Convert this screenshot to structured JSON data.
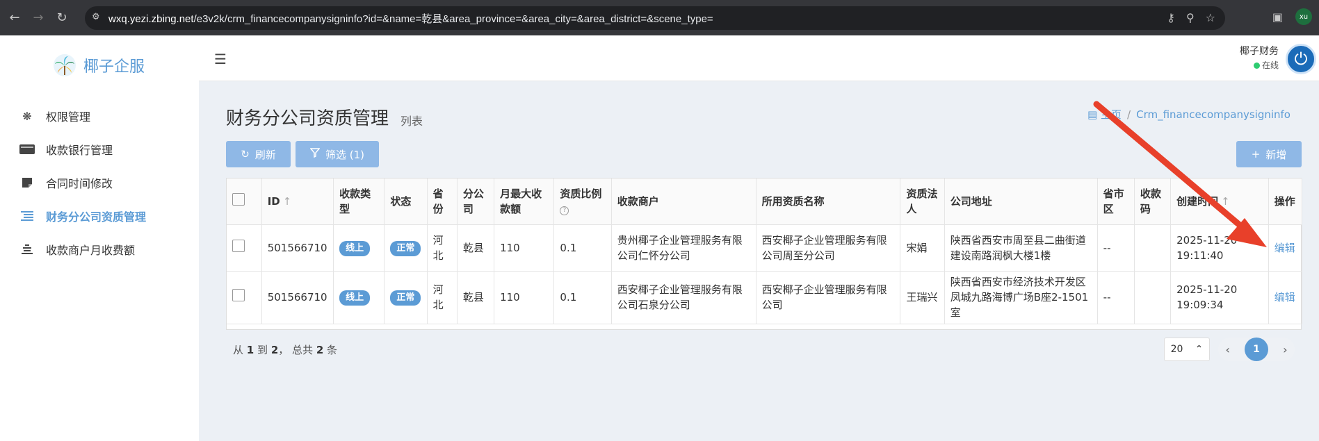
{
  "browser": {
    "url_host": "wxq.yezi.zbing.net",
    "url_path": "/e3v2k/crm_financecompanysigninfo?id=&name=乾县&area_province=&area_city=&area_district=&scene_type=",
    "profile_initials": "xu"
  },
  "sidebar": {
    "logo_text": "椰子企服",
    "items": [
      {
        "label": "权限管理",
        "icon": "fingerprint-icon"
      },
      {
        "label": "收款银行管理",
        "icon": "card-icon"
      },
      {
        "label": "合同时间修改",
        "icon": "note-icon"
      },
      {
        "label": "财务分公司资质管理",
        "icon": "list-icon",
        "active": true
      },
      {
        "label": "收款商户月收费额",
        "icon": "stack-icon"
      }
    ]
  },
  "header": {
    "user_name": "椰子财务",
    "user_status": "在线"
  },
  "page": {
    "title": "财务分公司资质管理",
    "subtitle": "列表",
    "breadcrumb": [
      "主页",
      "Crm_financecompanysigninfo"
    ],
    "refresh_label": "刷新",
    "filter_label": "筛选 (1)",
    "add_label": "新增"
  },
  "table": {
    "columns": [
      "ID",
      "收款类型",
      "状态",
      "省份",
      "分公司",
      "月最大收款额",
      "资质比例",
      "收款商户",
      "所用资质名称",
      "资质法人",
      "公司地址",
      "省市区",
      "收款码",
      "创建时间",
      "操作"
    ],
    "rows": [
      {
        "id": "501566710",
        "pay_type": "线上",
        "status": "正常",
        "province": "河北",
        "branch": "乾县",
        "max_amount": "110",
        "ratio": "0.1",
        "merchant": "贵州椰子企业管理服务有限公司仁怀分公司",
        "qualification": "西安椰子企业管理服务有限公司周至分公司",
        "legal_person": "宋娟",
        "address": "陕西省西安市周至县二曲街道建设南路润枫大楼1楼",
        "region": "--",
        "qrcode": "",
        "created": "2025-11-20 19:11:40",
        "action": "编辑"
      },
      {
        "id": "501566710",
        "pay_type": "线上",
        "status": "正常",
        "province": "河北",
        "branch": "乾县",
        "max_amount": "110",
        "ratio": "0.1",
        "merchant": "西安椰子企业管理服务有限公司石泉分公司",
        "qualification": "西安椰子企业管理服务有限公司",
        "legal_person": "王瑞兴",
        "address": "陕西省西安市经济技术开发区凤城九路海博广场B座2-1501室",
        "region": "--",
        "qrcode": "",
        "created": "2025-11-20 19:09:34",
        "action": "编辑"
      }
    ]
  },
  "pagination": {
    "from_prefix": "从",
    "from": "1",
    "to_prefix": "到",
    "to": "2",
    "total_prefix": "， 总共",
    "total": "2",
    "total_suffix": "条",
    "page_size": "20",
    "current_page": "1"
  },
  "annotation": {
    "arrow_color": "#e8402a"
  }
}
